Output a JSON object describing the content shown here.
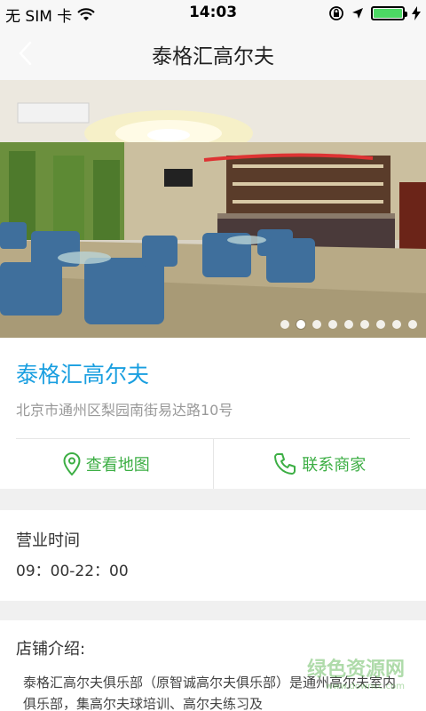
{
  "status_bar": {
    "carrier": "无 SIM 卡",
    "time": "14:03"
  },
  "nav": {
    "title": "泰格汇高尔夫"
  },
  "banner": {
    "total_slides": 9,
    "active_index": 1
  },
  "venue": {
    "name": "泰格汇高尔夫",
    "address": "北京市通州区梨园南街易达路10号"
  },
  "actions": {
    "map_label": "查看地图",
    "contact_label": "联系商家"
  },
  "hours": {
    "title": "营业时间",
    "value": "09：00-22：00"
  },
  "intro": {
    "title": "店铺介绍:",
    "text": "泰格汇高尔夫俱乐部（原智诚高尔夫俱乐部）是通州高尔夫室内俱乐部，集高尔夫球培训、高尔夫练习及"
  },
  "watermark": {
    "text": "绿色资源网",
    "sub": "www.downcc.com"
  },
  "colors": {
    "accent_blue": "#1a9fe0",
    "accent_green": "#3cae44",
    "battery_green": "#4cd964"
  }
}
